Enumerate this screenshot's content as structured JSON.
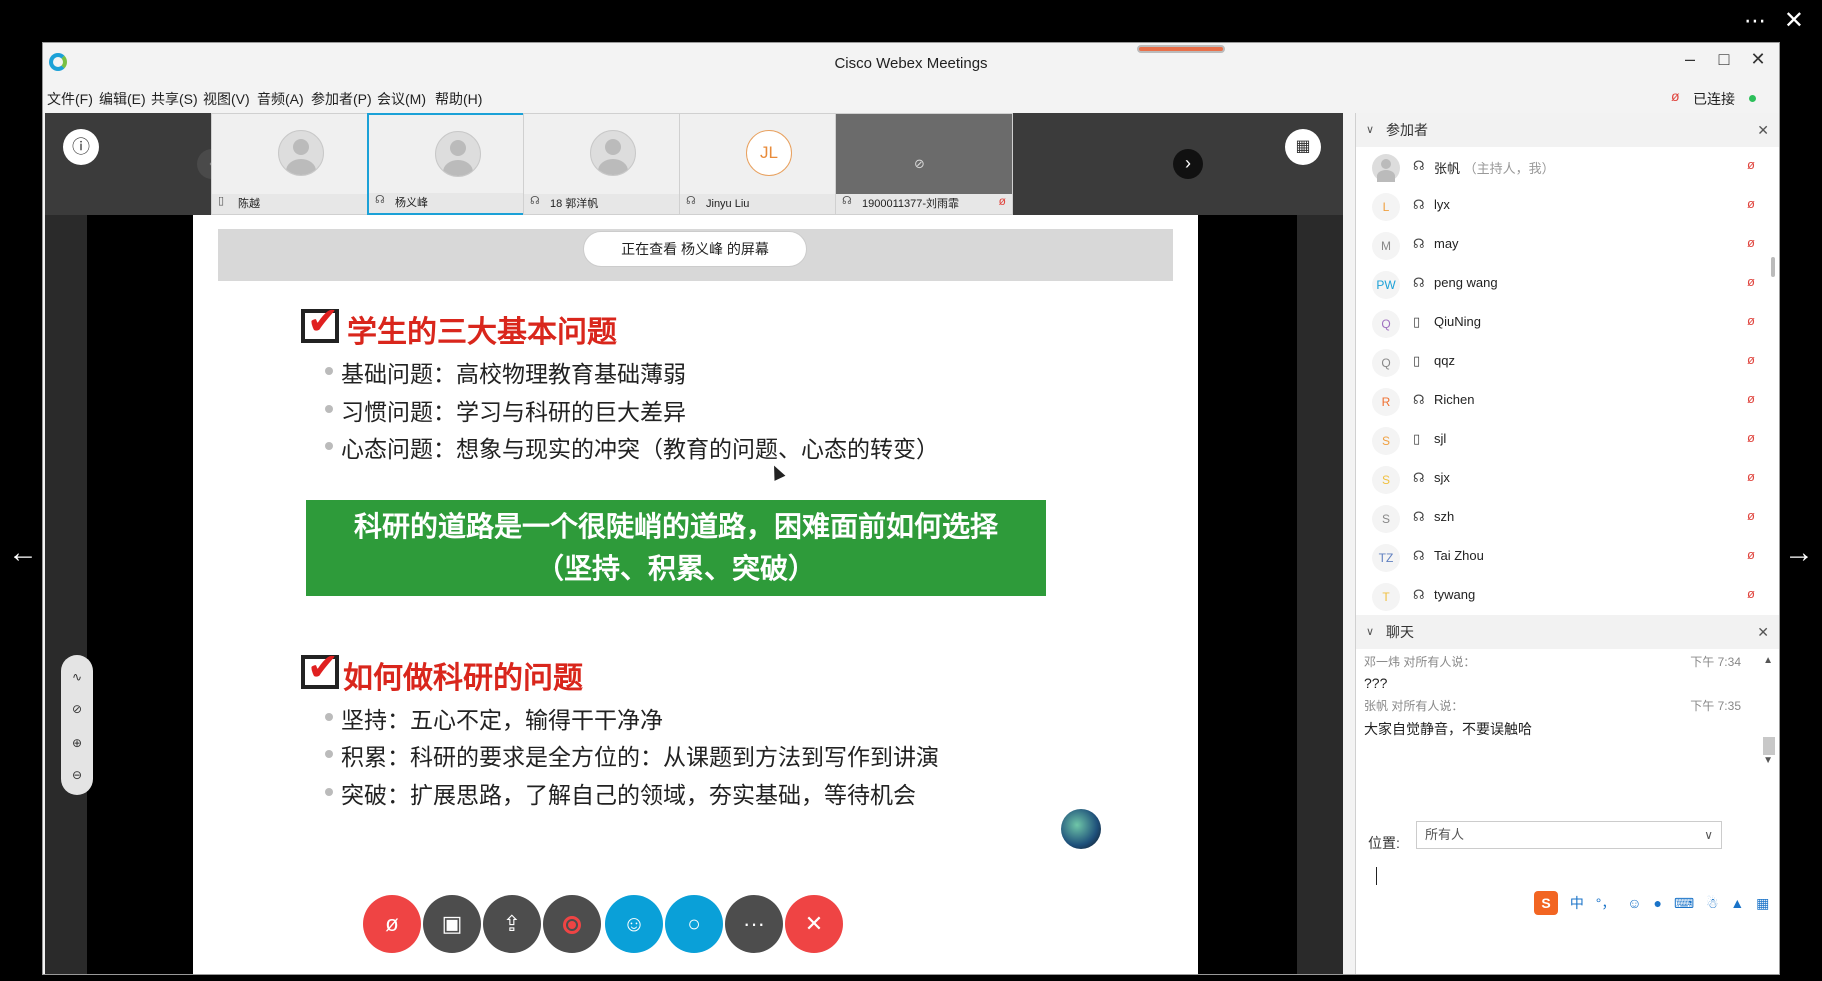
{
  "viewer": {
    "more_icon": "⋯",
    "close_icon": "✕",
    "prev_icon": "←",
    "next_icon": "→"
  },
  "window": {
    "title": "Cisco Webex Meetings",
    "min_icon": "–",
    "max_icon": "□",
    "close_icon": "✕"
  },
  "menu": [
    {
      "label": "文件(F)"
    },
    {
      "label": "编辑(E)"
    },
    {
      "label": "共享(S)"
    },
    {
      "label": "视图(V)"
    },
    {
      "label": "音频(A)"
    },
    {
      "label": "参加者(P)"
    },
    {
      "label": "会议(M)"
    },
    {
      "label": "帮助(H)"
    }
  ],
  "connection": {
    "status": "已连接",
    "mic_icon": "ø",
    "dot_color": "#2cbf5a"
  },
  "thumbnails": {
    "info_icon": "ⓘ",
    "prev_icon": "‹",
    "next_icon": "›",
    "layout_icon": "▦",
    "items": [
      {
        "name": "陈越",
        "icon": "▯",
        "muted": "ø"
      },
      {
        "name": "杨义峰",
        "icon": "☊",
        "muted": "ø"
      },
      {
        "name": "18 郭洋帆",
        "icon": "☊",
        "muted": "ø"
      },
      {
        "name": "Jinyu Liu",
        "icon": "☊",
        "muted": "ø",
        "initials": "JL"
      },
      {
        "name": "1900011377-刘雨霏",
        "icon": "☊",
        "muted": "ø",
        "cam_off": "⊘"
      }
    ]
  },
  "slide": {
    "viewing_label": "正在查看 杨义峰 的屏幕",
    "section1_title": "学生的三大基本问题",
    "section1_bullets": [
      "基础问题：高校物理教育基础薄弱",
      "习惯问题：学习与科研的巨大差异",
      "心态问题：想象与现实的冲突（教育的问题、心态的转变）"
    ],
    "green_line1": "科研的道路是一个很陡峭的道路，困难面前如何选择",
    "green_line2": "（坚持、积累、突破）",
    "section2_title": "如何做科研的问题",
    "section2_bullets": [
      "坚持：五心不定，输得干干净净",
      "积累：科研的要求是全方位的：从课题到方法到写作到讲演",
      "突破：扩展思路，了解自己的领域，夯实基础，等待机会"
    ]
  },
  "annotation_tools": [
    {
      "icon": "∿"
    },
    {
      "icon": "⊘"
    },
    {
      "icon": "⊕"
    },
    {
      "icon": "⊖"
    }
  ],
  "controls": {
    "mute_icon": "ø",
    "video_icon": "▣",
    "share_icon": "⇪",
    "more_icon": "···",
    "participants_icon": "☺",
    "chat_icon": "○",
    "leave_icon": "✕"
  },
  "participants_panel": {
    "title": "参加者",
    "collapse_icon": "∨",
    "close_icon": "✕",
    "items": [
      {
        "initials": "",
        "name": "张帆",
        "role": "（主持人，我）",
        "type": "☊",
        "mic": "ø",
        "color": "#888"
      },
      {
        "initials": "L",
        "name": "lyx",
        "role": "",
        "type": "☊",
        "mic": "ø",
        "color": "#f0a040"
      },
      {
        "initials": "M",
        "name": "may",
        "role": "",
        "type": "☊",
        "mic": "ø",
        "color": "#888"
      },
      {
        "initials": "PW",
        "name": "peng wang",
        "role": "",
        "type": "☊",
        "mic": "ø",
        "color": "#1ba1d7"
      },
      {
        "initials": "Q",
        "name": "QiuNing",
        "role": "",
        "type": "▯",
        "mic": "ø",
        "color": "#a070c0"
      },
      {
        "initials": "Q",
        "name": "qqz",
        "role": "",
        "type": "▯",
        "mic": "ø",
        "color": "#888"
      },
      {
        "initials": "R",
        "name": "Richen",
        "role": "",
        "type": "☊",
        "mic": "ø",
        "color": "#f07030"
      },
      {
        "initials": "S",
        "name": "sjl",
        "role": "",
        "type": "▯",
        "mic": "ø",
        "color": "#f0a040"
      },
      {
        "initials": "S",
        "name": "sjx",
        "role": "",
        "type": "☊",
        "mic": "ø",
        "color": "#f0c040"
      },
      {
        "initials": "S",
        "name": "szh",
        "role": "",
        "type": "☊",
        "mic": "ø",
        "color": "#888"
      },
      {
        "initials": "TZ",
        "name": "Tai Zhou",
        "role": "",
        "type": "☊",
        "mic": "ø",
        "color": "#6080c0"
      },
      {
        "initials": "T",
        "name": "tywang",
        "role": "",
        "type": "☊",
        "mic": "ø",
        "color": "#f0c040"
      }
    ]
  },
  "chat_panel": {
    "title": "聊天",
    "collapse_icon": "∨",
    "close_icon": "✕",
    "messages": [
      {
        "meta": "邓一炜 对所有人说：",
        "time": "下午 7:34",
        "text": "???"
      },
      {
        "meta": "张帆 对所有人说：",
        "time": "下午 7:35",
        "text": "大家自觉静音，不要误触哈"
      }
    ],
    "to_label": "位置:",
    "to_value": "所有人",
    "dropdown_icon": "∨",
    "scroll_up": "▲",
    "scroll_down": "▼"
  },
  "ime": {
    "logo": "S",
    "items": [
      "中",
      "°，",
      "☺",
      "●",
      "⌨",
      "☃",
      "▲",
      "▦"
    ]
  }
}
